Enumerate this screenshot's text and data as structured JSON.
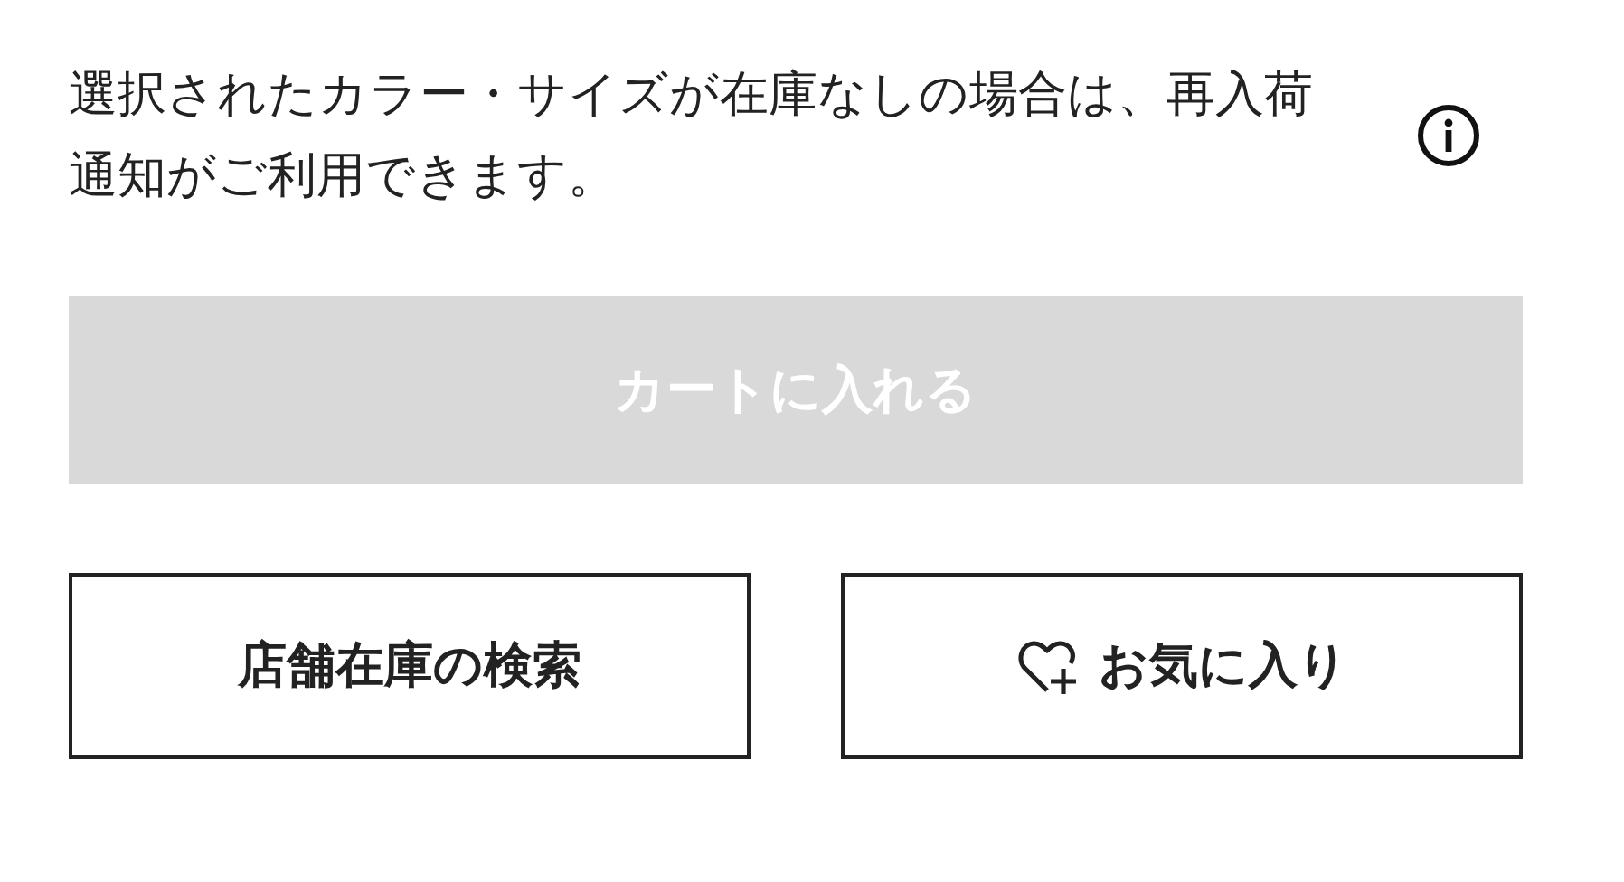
{
  "notice": {
    "text": "選択されたカラー・サイズが在庫なしの場合は、再入荷通知がご利用できます。"
  },
  "cart_button": {
    "label": "カートに入れる",
    "disabled": true
  },
  "buttons": [
    {
      "kind": "plain",
      "label": "店舗在庫の検索"
    },
    {
      "kind": "favorite",
      "label": "お気に入り"
    }
  ]
}
